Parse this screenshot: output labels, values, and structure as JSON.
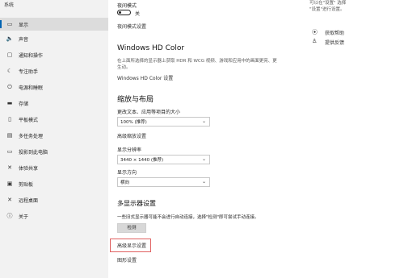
{
  "sidebar": {
    "title": "系统",
    "items": [
      {
        "label": "显示",
        "icon": "display-icon",
        "glyph": "▭"
      },
      {
        "label": "声音",
        "icon": "speaker-icon",
        "glyph": "🔈"
      },
      {
        "label": "通知和操作",
        "icon": "notification-icon",
        "glyph": "▢"
      },
      {
        "label": "专注助手",
        "icon": "moon-icon",
        "glyph": "☾"
      },
      {
        "label": "电源和睡眠",
        "icon": "power-icon",
        "glyph": "⏻"
      },
      {
        "label": "存储",
        "icon": "storage-icon",
        "glyph": "▬"
      },
      {
        "label": "平板模式",
        "icon": "tablet-icon",
        "glyph": "▯"
      },
      {
        "label": "多任务处理",
        "icon": "multitask-icon",
        "glyph": "▤"
      },
      {
        "label": "投影到此电脑",
        "icon": "projector-icon",
        "glyph": "▭"
      },
      {
        "label": "体验共享",
        "icon": "share-icon",
        "glyph": "✕"
      },
      {
        "label": "剪贴板",
        "icon": "clipboard-icon",
        "glyph": "▣"
      },
      {
        "label": "远程桌面",
        "icon": "remote-desktop-icon",
        "glyph": "✕"
      },
      {
        "label": "关于",
        "icon": "info-icon",
        "glyph": "ⓘ"
      }
    ]
  },
  "night_light": {
    "label": "夜间模式",
    "toggle_state": "关",
    "settings_link": "夜间模式设置"
  },
  "hd_color": {
    "heading": "Windows HD Color",
    "description": "在上面所选择的显示器上获取 HDR 和 WCG 视频、游戏和应用中的画面更亮、更生动。",
    "settings_link": "Windows HD Color 设置"
  },
  "scale_layout": {
    "heading": "缩放与布局",
    "scale_label": "更改文本、应用等项目的大小",
    "scale_value": "100% (推荐)",
    "advanced_scale_link": "高级缩放设置",
    "resolution_label": "显示分辨率",
    "resolution_value": "3440 × 1440 (推荐)",
    "orientation_label": "显示方向",
    "orientation_value": "横向"
  },
  "multi_display": {
    "heading": "多显示器设置",
    "description": "一些旧式显示器可能不会进行自动连接，选择\"检测\"即可尝试手动连接。",
    "detect_button": "检测",
    "advanced_display_link": "高级显示设置",
    "graphics_link": "图形设置"
  },
  "right_panel": {
    "top_text_1": "可以在\"设置\"  选择",
    "top_text_2": "\"设置\"进行设置。",
    "help_link": "获取帮助",
    "feedback_link": "提供反馈"
  }
}
